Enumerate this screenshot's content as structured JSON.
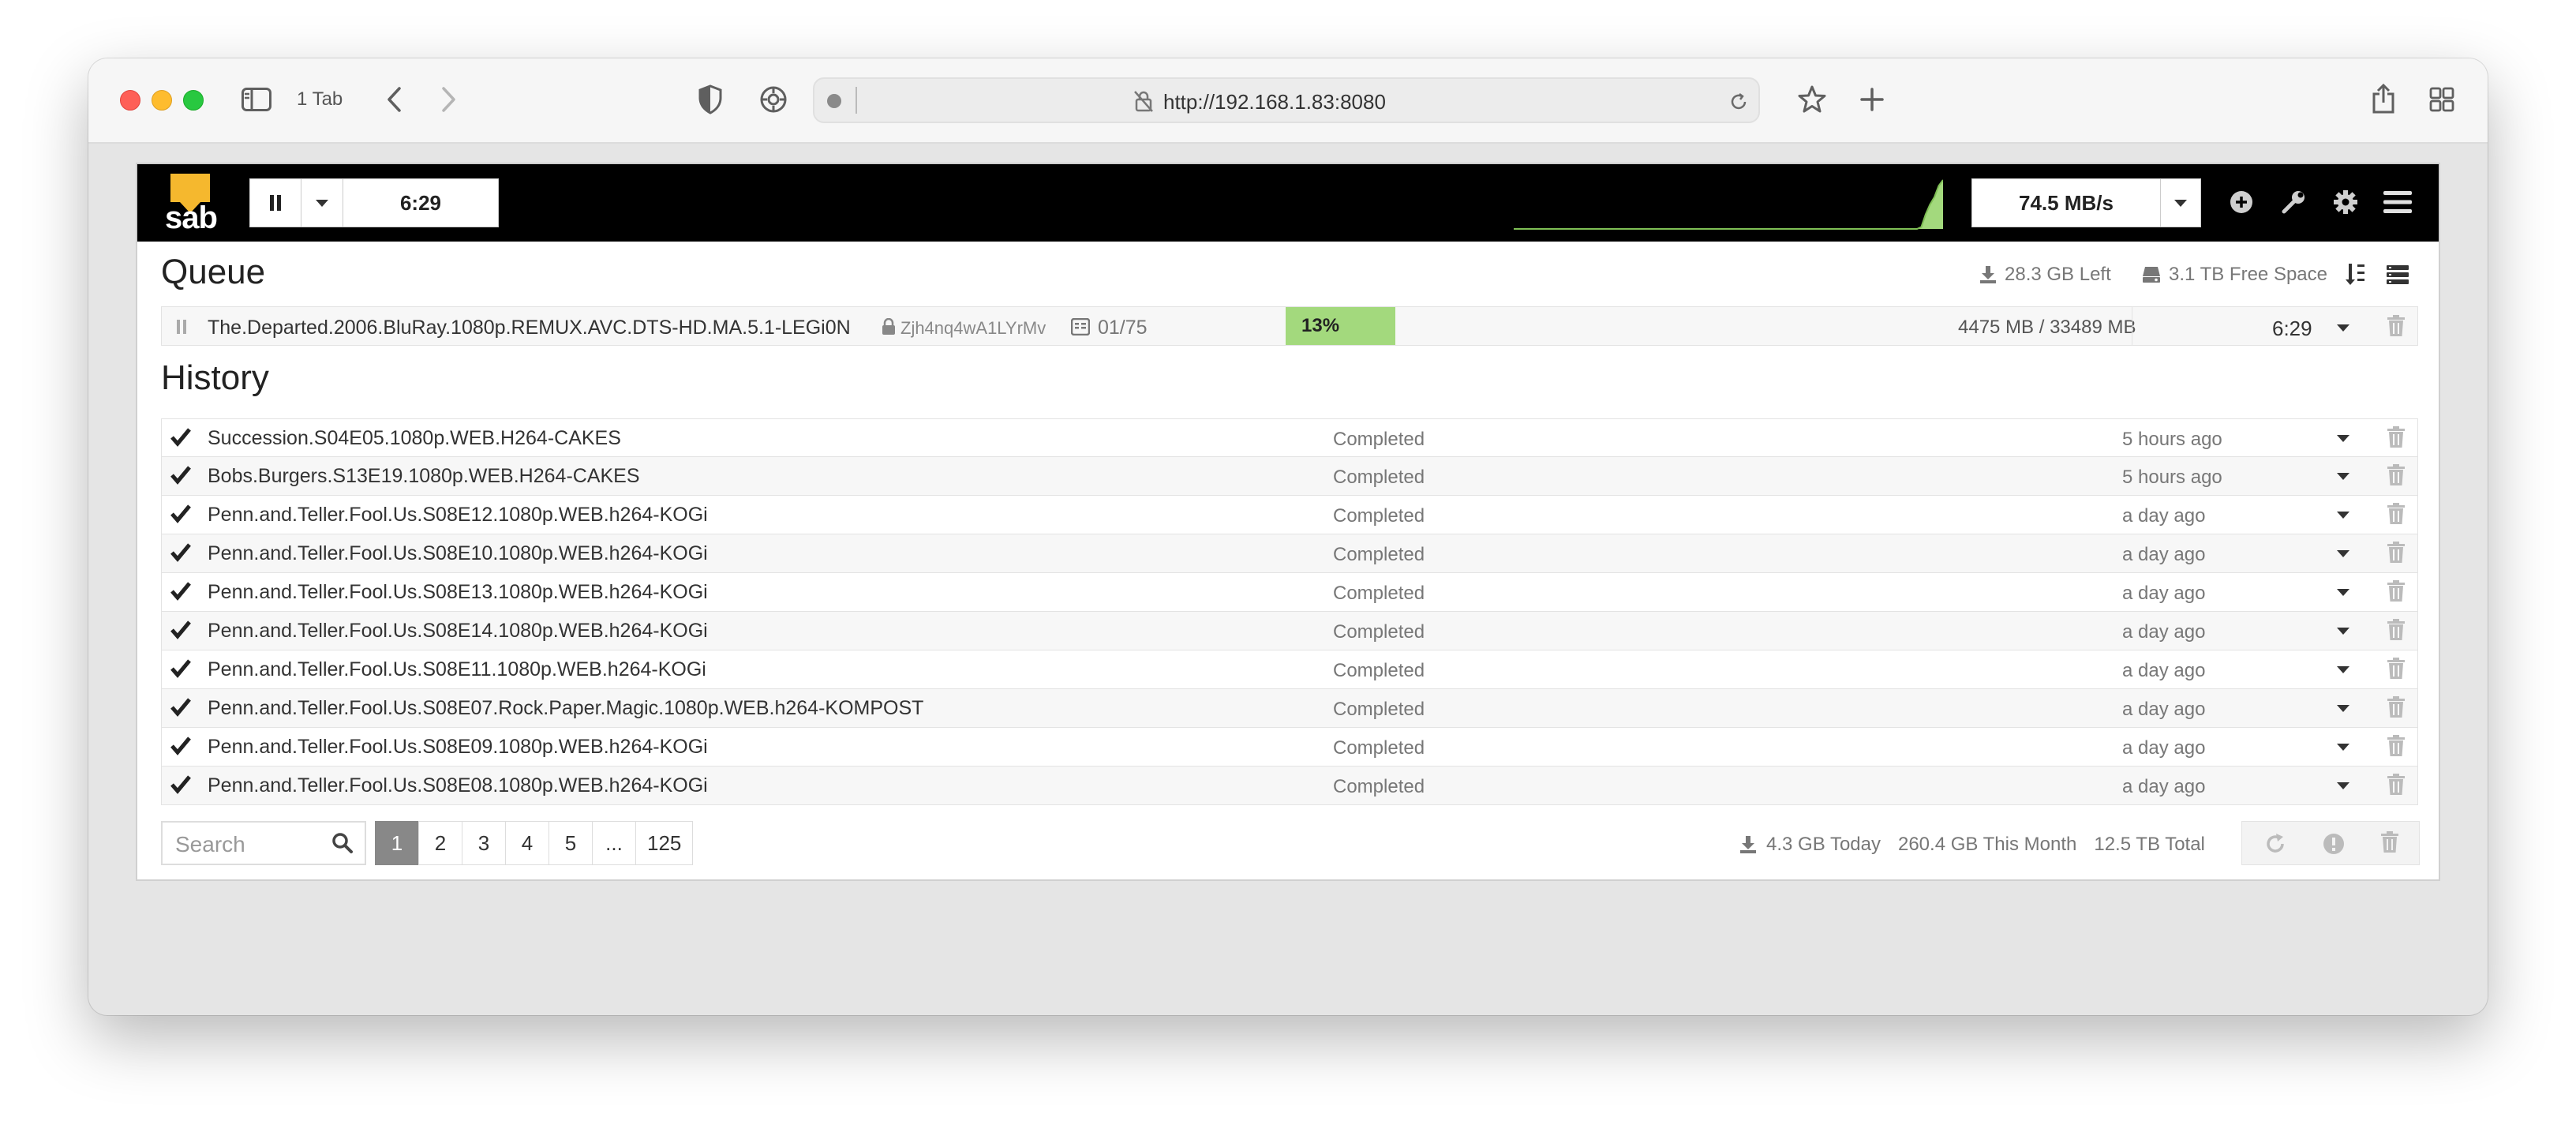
{
  "browser": {
    "tab_count": "1 Tab",
    "url": "http://192.168.1.83:8080"
  },
  "navbar": {
    "logo_text": "sab",
    "timer": "6:29",
    "speed": "74.5 MB/s",
    "speed_history_percent": [
      0,
      0,
      0,
      0,
      0,
      0,
      0,
      0,
      0,
      0,
      0,
      0,
      0,
      0,
      0,
      0,
      0,
      0,
      0,
      0,
      0,
      0,
      0,
      0,
      0,
      0,
      0,
      0,
      0,
      0,
      0,
      0,
      0,
      0,
      0,
      0,
      0,
      0,
      0,
      0,
      0,
      0,
      0,
      0,
      0,
      0,
      0,
      0,
      0,
      0,
      0,
      0,
      0,
      0,
      0,
      0,
      0,
      0,
      0,
      0,
      0,
      0,
      0,
      0,
      0,
      0,
      0,
      0,
      0,
      0,
      0,
      0,
      0,
      0,
      0,
      0,
      0,
      0,
      0,
      0,
      0,
      0,
      0,
      0,
      0,
      0,
      0,
      0,
      0,
      0,
      0,
      0,
      0,
      0,
      4,
      30,
      50,
      65,
      88,
      100
    ]
  },
  "queue": {
    "title": "Queue",
    "left": "28.3 GB Left",
    "free_space": "3.1 TB Free Space",
    "items": [
      {
        "name": "The.Departed.2006.BluRay.1080p.REMUX.AVC.DTS-HD.MA.5.1-LEGi0N",
        "password": "Zjh4nq4wA1LYrMv",
        "files": "01/75",
        "progress_percent": 13,
        "progress_label": "13%",
        "size": "4475 MB / 33489 MB",
        "eta": "6:29"
      }
    ]
  },
  "history": {
    "title": "History",
    "items": [
      {
        "name": "Succession.S04E05.1080p.WEB.H264-CAKES",
        "status": "Completed",
        "time": "5 hours ago"
      },
      {
        "name": "Bobs.Burgers.S13E19.1080p.WEB.H264-CAKES",
        "status": "Completed",
        "time": "5 hours ago"
      },
      {
        "name": "Penn.and.Teller.Fool.Us.S08E12.1080p.WEB.h264-KOGi",
        "status": "Completed",
        "time": "a day ago"
      },
      {
        "name": "Penn.and.Teller.Fool.Us.S08E10.1080p.WEB.h264-KOGi",
        "status": "Completed",
        "time": "a day ago"
      },
      {
        "name": "Penn.and.Teller.Fool.Us.S08E13.1080p.WEB.h264-KOGi",
        "status": "Completed",
        "time": "a day ago"
      },
      {
        "name": "Penn.and.Teller.Fool.Us.S08E14.1080p.WEB.h264-KOGi",
        "status": "Completed",
        "time": "a day ago"
      },
      {
        "name": "Penn.and.Teller.Fool.Us.S08E11.1080p.WEB.h264-KOGi",
        "status": "Completed",
        "time": "a day ago"
      },
      {
        "name": "Penn.and.Teller.Fool.Us.S08E07.Rock.Paper.Magic.1080p.WEB.h264-KOMPOST",
        "status": "Completed",
        "time": "a day ago"
      },
      {
        "name": "Penn.and.Teller.Fool.Us.S08E09.1080p.WEB.h264-KOGi",
        "status": "Completed",
        "time": "a day ago"
      },
      {
        "name": "Penn.and.Teller.Fool.Us.S08E08.1080p.WEB.h264-KOGi",
        "status": "Completed",
        "time": "a day ago"
      }
    ],
    "search_placeholder": "Search",
    "pages": [
      "1",
      "2",
      "3",
      "4",
      "5",
      "...",
      "125"
    ],
    "active_page": "1",
    "today": "4.3 GB Today",
    "month": "260.4 GB This Month",
    "total": "12.5 TB Total"
  },
  "colors": {
    "progress": "#a3d97d",
    "navbar": "#000000",
    "logo_yellow": "#f5b82e"
  }
}
